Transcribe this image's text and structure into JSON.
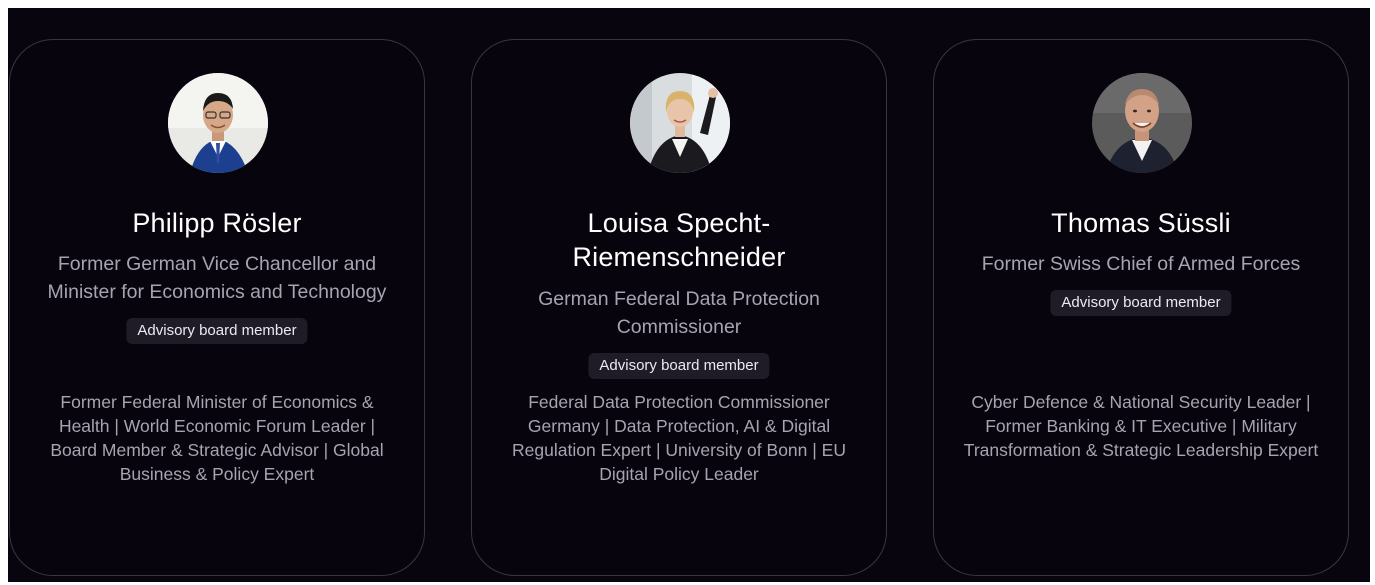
{
  "colors": {
    "background": "#08050f",
    "card_border": "#3a3448",
    "badge_background": "#1f1c27",
    "muted_text": "#a7a3b2"
  },
  "members": [
    {
      "name": "Philipp Rösler",
      "title": "Former German Vice Chancellor and Minister for Economics and Technology",
      "badge": "Advisory board member",
      "bio": "Former Federal Minister of Economics & Health | World Economic Forum Leader | Board Member & Strategic Advisor | Global Business & Policy Expert",
      "avatar_icon": "portrait-photo"
    },
    {
      "name": "Louisa Specht-Riemenschneider",
      "title": "German Federal Data Protection Commissioner",
      "badge": "Advisory board member",
      "bio": "Federal Data Protection Commissioner Germany | Data Protection, AI & Digital Regulation Expert | University of Bonn | EU Digital Policy Leader",
      "avatar_icon": "portrait-photo"
    },
    {
      "name": "Thomas Süssli",
      "title": "Former Swiss Chief of Armed Forces",
      "badge": "Advisory board member",
      "bio": "Cyber Defence & National Security Leader | Former Banking & IT Executive | Military Transformation & Strategic Leadership Expert",
      "avatar_icon": "portrait-photo"
    }
  ]
}
